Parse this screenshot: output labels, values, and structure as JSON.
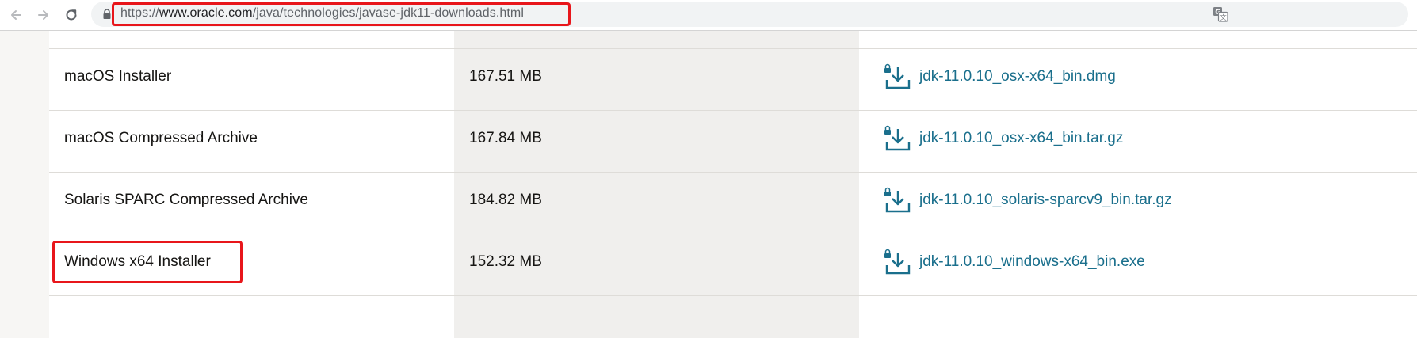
{
  "browser": {
    "back_icon": "arrow-left-icon",
    "forward_icon": "arrow-right-icon",
    "reload_icon": "reload-icon",
    "lock_icon": "lock-icon",
    "translate_icon": "translate-icon",
    "url_scheme": "https://",
    "url_host": "www.oracle.com",
    "url_path": "/java/technologies/javase-jdk11-downloads.html"
  },
  "downloads": {
    "rows": [
      {
        "product": "macOS Installer",
        "size": "167.51 MB",
        "file": "jdk-11.0.10_osx-x64_bin.dmg"
      },
      {
        "product": "macOS Compressed Archive",
        "size": "167.84 MB",
        "file": "jdk-11.0.10_osx-x64_bin.tar.gz"
      },
      {
        "product": "Solaris SPARC Compressed Archive",
        "size": "184.82 MB",
        "file": "jdk-11.0.10_solaris-sparcv9_bin.tar.gz"
      },
      {
        "product": "Windows x64 Installer",
        "size": "152.32 MB",
        "file": "jdk-11.0.10_windows-x64_bin.exe"
      }
    ],
    "download_icon": "locked-download-icon",
    "link_color": "#1a6f8c",
    "annotation_color": "#e8161b"
  }
}
